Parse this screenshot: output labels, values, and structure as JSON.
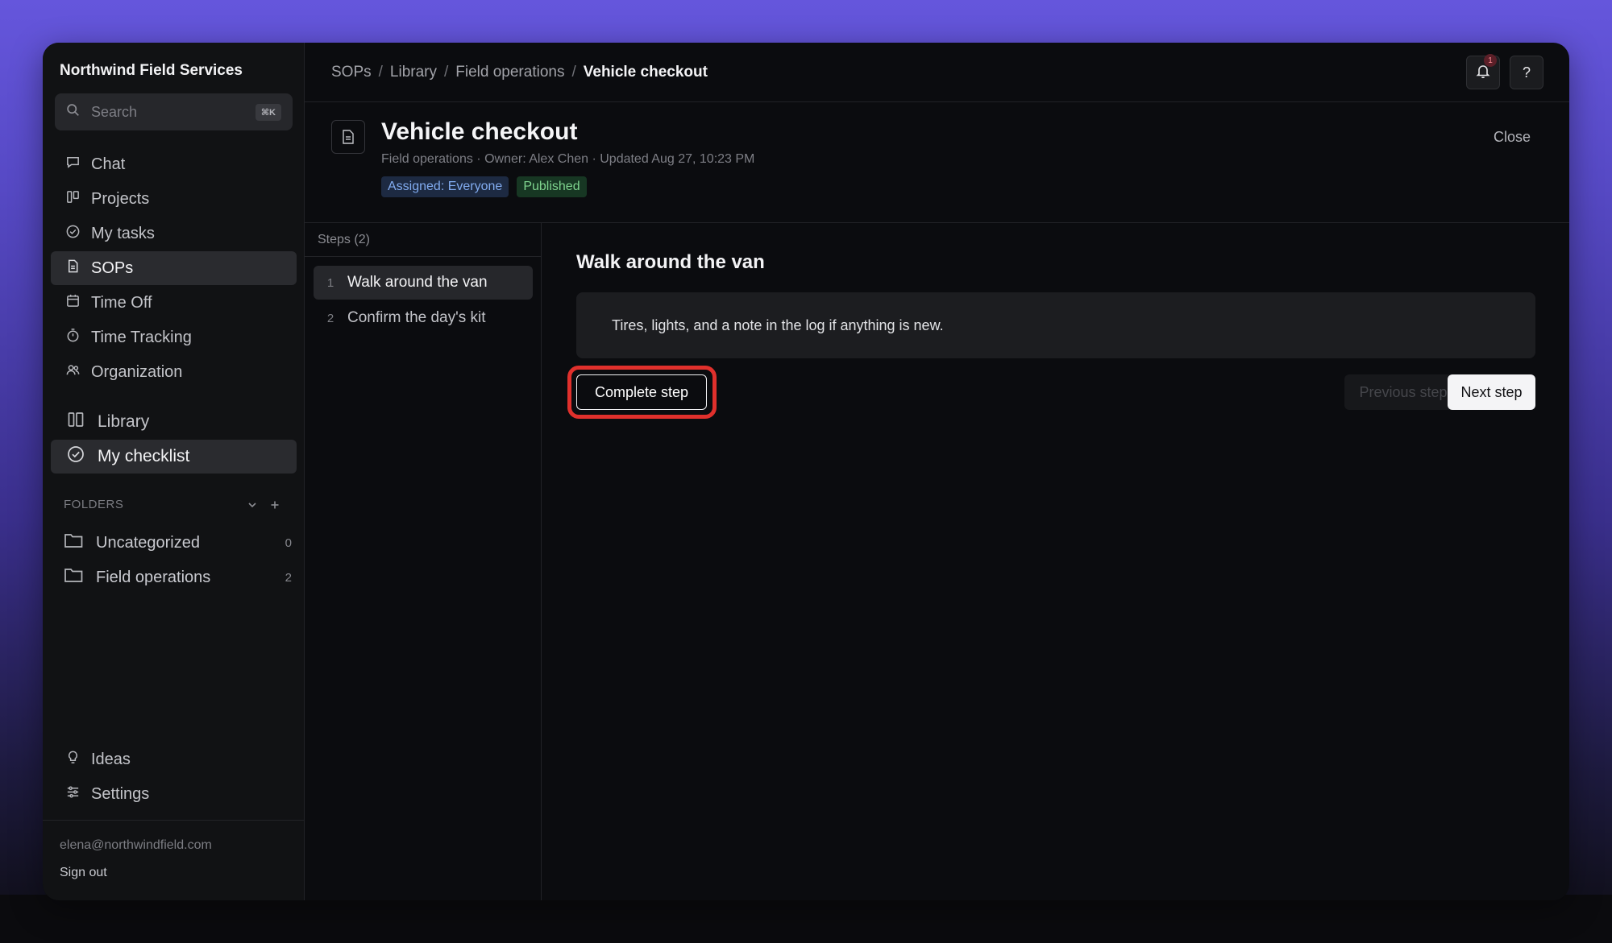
{
  "sidebar": {
    "org_name": "Northwind Field Services",
    "search": {
      "placeholder": "Search",
      "shortcut": "⌘K"
    },
    "nav": [
      {
        "label": "Chat",
        "icon": "chat-icon"
      },
      {
        "label": "Projects",
        "icon": "projects-icon"
      },
      {
        "label": "My tasks",
        "icon": "check-circle-icon"
      },
      {
        "label": "SOPs",
        "icon": "document-icon",
        "active": true
      },
      {
        "label": "Time Off",
        "icon": "calendar-icon"
      },
      {
        "label": "Time Tracking",
        "icon": "stopwatch-icon"
      },
      {
        "label": "Organization",
        "icon": "people-icon"
      }
    ],
    "sub_nav": [
      {
        "label": "Library",
        "icon": "library-icon"
      },
      {
        "label": "My checklist",
        "icon": "check-circle-icon",
        "active": true
      }
    ],
    "folders": {
      "heading": "FOLDERS",
      "items": [
        {
          "label": "Uncategorized",
          "count": "0"
        },
        {
          "label": "Field operations",
          "count": "2"
        }
      ]
    },
    "bottom_nav": [
      {
        "label": "Ideas",
        "icon": "lightbulb-icon"
      },
      {
        "label": "Settings",
        "icon": "sliders-icon"
      }
    ],
    "user_email": "elena@northwindfield.com",
    "sign_out": "Sign out"
  },
  "topbar": {
    "breadcrumb": [
      "SOPs",
      "Library",
      "Field operations",
      "Vehicle checkout"
    ],
    "separator": "/",
    "notifications_count": "1",
    "help_label": "?"
  },
  "document": {
    "title": "Vehicle checkout",
    "meta": "Field operations · Owner: Alex Chen · Updated Aug 27, 10:23 PM",
    "tags": {
      "assigned": "Assigned: Everyone",
      "status": "Published"
    },
    "close_label": "Close"
  },
  "steps": {
    "heading": "Steps (2)",
    "items": [
      {
        "num": "1",
        "label": "Walk around the van",
        "active": true
      },
      {
        "num": "2",
        "label": "Confirm the day's kit"
      }
    ]
  },
  "step_detail": {
    "title": "Walk around the van",
    "body": "Tires, lights, and a note in the log if anything is new.",
    "complete_label": "Complete step",
    "prev_label": "Previous step",
    "next_label": "Next step"
  },
  "colors": {
    "accent_highlight": "#e0302c",
    "assigned_tag": "#82acf0",
    "published_tag": "#7fd48e",
    "background_gradient_top": "#6556dc"
  }
}
